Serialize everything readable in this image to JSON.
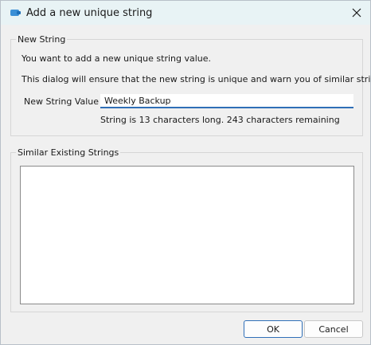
{
  "window": {
    "title": "Add a new unique string"
  },
  "new_string": {
    "legend": "New String",
    "intro_line1": "You want to add a new unique string value.",
    "intro_line2": "This dialog will ensure that the new string is unique and warn you of similar strings.",
    "value_label": "New String Value",
    "value": "Weekly Backup",
    "status": "String is 13 characters long. 243 characters remaining"
  },
  "similar": {
    "legend": "Similar Existing Strings",
    "items": []
  },
  "buttons": {
    "ok_label": "OK",
    "cancel_label": "Cancel"
  },
  "colors": {
    "accent": "#2f6fb7",
    "titlebar": "#e8f3f5",
    "dialog_bg": "#f0f0f0"
  },
  "icons": {
    "app": "string-dialog-icon",
    "close": "close-icon"
  }
}
